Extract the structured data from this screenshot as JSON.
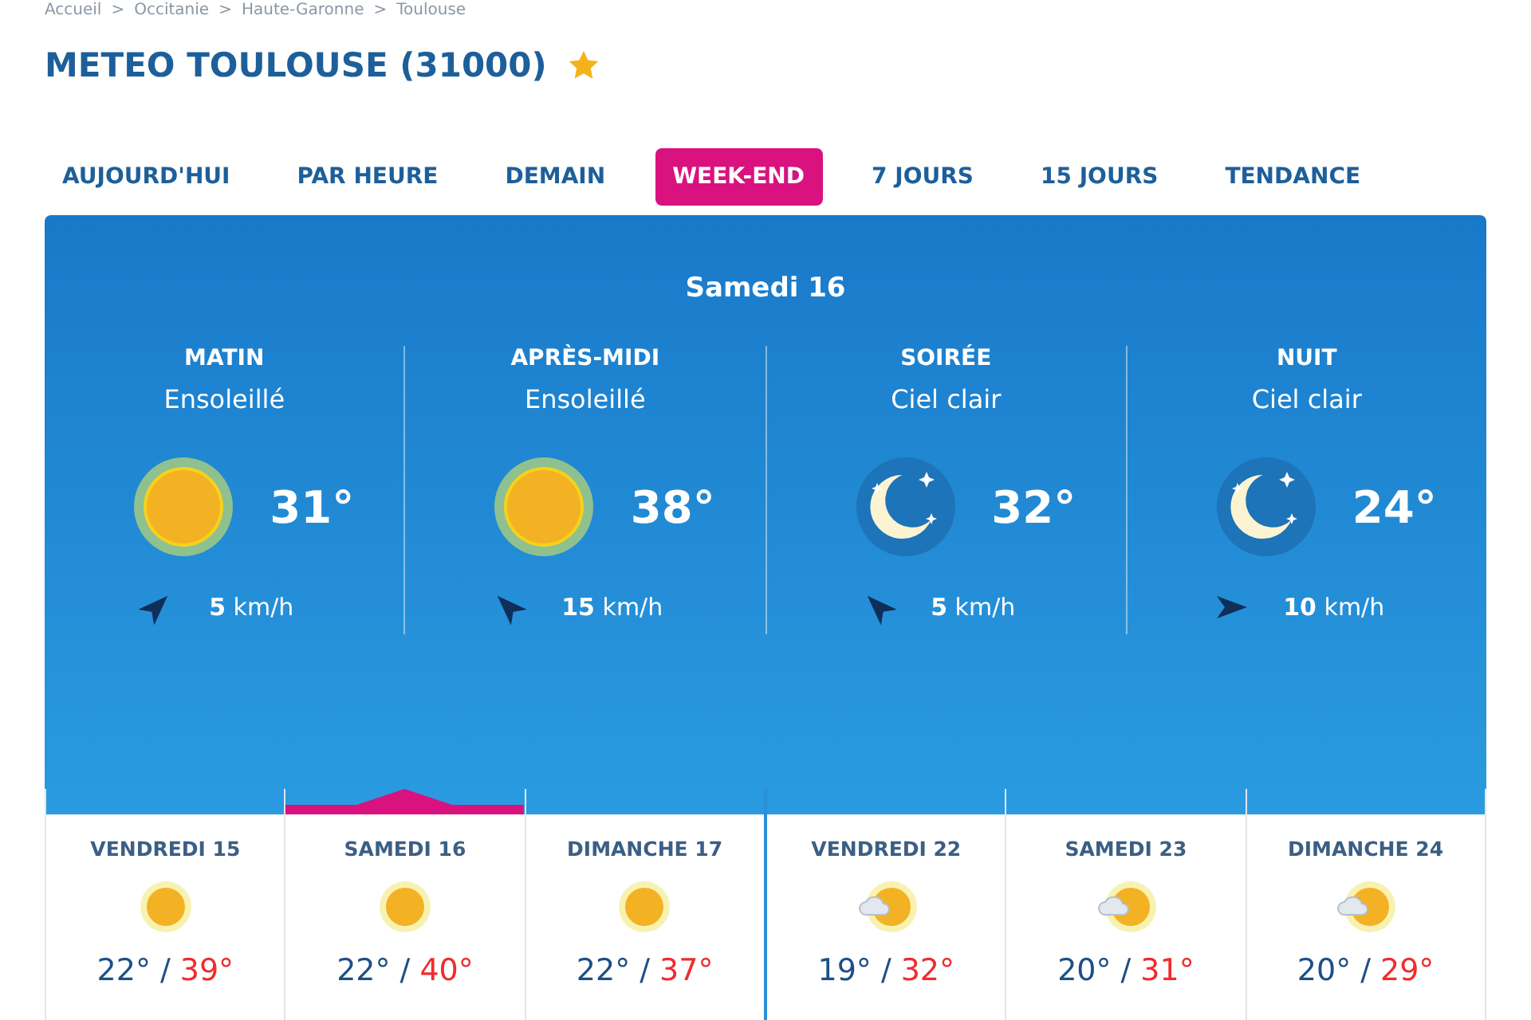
{
  "breadcrumb": [
    "Accueil",
    ">",
    "Occitanie",
    ">",
    "Haute-Garonne",
    ">",
    "Toulouse"
  ],
  "title": "METEO TOULOUSE (31000)",
  "favorite": true,
  "tabs": [
    {
      "label": "AUJOURD'HUI",
      "selected": false
    },
    {
      "label": "PAR HEURE",
      "selected": false
    },
    {
      "label": "DEMAIN",
      "selected": false
    },
    {
      "label": "WEEK-END",
      "selected": true
    },
    {
      "label": "7 JOURS",
      "selected": false
    },
    {
      "label": "15 JOURS",
      "selected": false
    },
    {
      "label": "TENDANCE",
      "selected": false
    }
  ],
  "panel": {
    "day": "Samedi 16",
    "periods": [
      {
        "name": "MATIN",
        "condition": "Ensoleillé",
        "kind": "sun",
        "temp": "31°",
        "wind": {
          "kind": "northeast",
          "speed": "5",
          "unit": "km/h"
        }
      },
      {
        "name": "APRÈS-MIDI",
        "condition": "Ensoleillé",
        "kind": "sun",
        "temp": "38°",
        "wind": {
          "kind": "northwest",
          "speed": "15",
          "unit": "km/h"
        }
      },
      {
        "name": "SOIRÉE",
        "condition": "Ciel clair",
        "kind": "moon",
        "temp": "32°",
        "wind": {
          "kind": "northwest",
          "speed": "5",
          "unit": "km/h"
        }
      },
      {
        "name": "NUIT",
        "condition": "Ciel clair",
        "kind": "moon",
        "temp": "24°",
        "wind": {
          "kind": "east",
          "speed": "10",
          "unit": "km/h"
        }
      }
    ]
  },
  "days": [
    {
      "name": "VENDREDI 15",
      "kind": "sun",
      "low": "22°",
      "separator": "/",
      "high": "39°",
      "selected": false,
      "group_start": false
    },
    {
      "name": "SAMEDI 16",
      "kind": "sun",
      "low": "22°",
      "separator": "/",
      "high": "40°",
      "selected": true,
      "group_start": false
    },
    {
      "name": "DIMANCHE 17",
      "kind": "sun",
      "low": "22°",
      "separator": "/",
      "high": "37°",
      "selected": false,
      "group_start": false
    },
    {
      "name": "VENDREDI 22",
      "kind": "sun_cloud",
      "low": "19°",
      "separator": "/",
      "high": "32°",
      "selected": false,
      "group_start": true
    },
    {
      "name": "SAMEDI 23",
      "kind": "sun_cloud",
      "low": "20°",
      "separator": "/",
      "high": "31°",
      "selected": false,
      "group_start": false
    },
    {
      "name": "DIMANCHE 24",
      "kind": "sun_cloud",
      "low": "20°",
      "separator": "/",
      "high": "29°",
      "selected": false,
      "group_start": false
    }
  ]
}
